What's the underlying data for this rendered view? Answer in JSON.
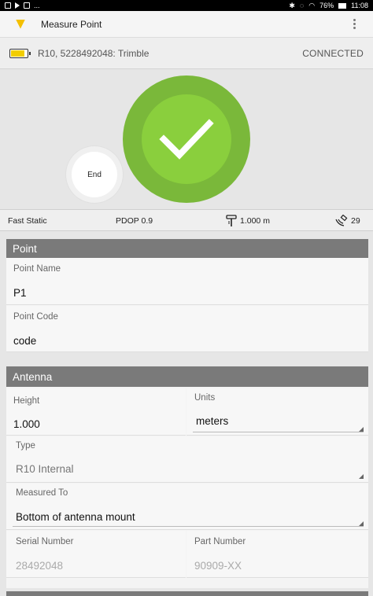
{
  "status_bar": {
    "battery_pct": "76%",
    "time": "11:08",
    "overflow": "..."
  },
  "app_bar": {
    "title": "Measure Point"
  },
  "device": {
    "name": "R10, 5228492048: Trimble",
    "status": "CONNECTED",
    "battery_level": 0.78
  },
  "measure": {
    "end_label": "End"
  },
  "info": {
    "method": "Fast Static",
    "pdop": "PDOP 0.9",
    "antenna_height": "1.000 m",
    "satellites": "29"
  },
  "point": {
    "header": "Point",
    "name_label": "Point Name",
    "name_value": "P1",
    "code_label": "Point Code",
    "code_value": "code"
  },
  "antenna": {
    "header": "Antenna",
    "height_label": "Height",
    "height_value": "1.000",
    "units_label": "Units",
    "units_value": "meters",
    "type_label": "Type",
    "type_value": "R10 Internal",
    "measured_to_label": "Measured To",
    "measured_to_value": "Bottom of antenna mount",
    "serial_label": "Serial Number",
    "serial_value": "28492048",
    "part_label": "Part Number",
    "part_value": "90909-XX"
  },
  "colors": {
    "accent_green": "#8acf3d",
    "header_gray": "#7a7a7a",
    "battery_yellow": "#f2cd00"
  }
}
